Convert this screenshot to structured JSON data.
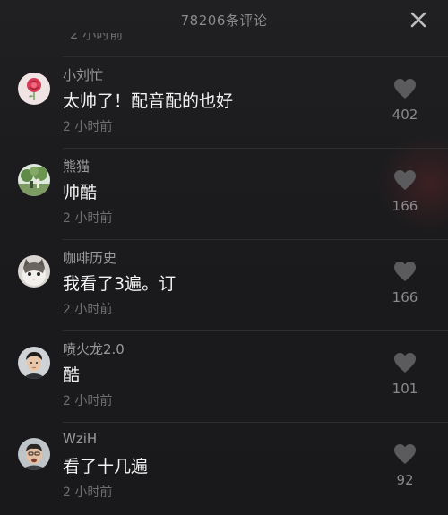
{
  "header": {
    "title": "78206条评论",
    "peek_text": "2 小时前"
  },
  "comments": [
    {
      "username": "小刘忙",
      "text": "太帅了！配音配的也好",
      "time": "2 小时前",
      "likes": "402",
      "avatar": "rose-avatar"
    },
    {
      "username": "熊猫",
      "text": "帅酷",
      "time": "2 小时前",
      "likes": "166",
      "avatar": "landscape-avatar"
    },
    {
      "username": "咖啡历史",
      "text": "我看了3遍。订",
      "time": "2 小时前",
      "likes": "166",
      "avatar": "cat-avatar"
    },
    {
      "username": "喷火龙2.0",
      "text": "酷",
      "time": "2 小时前",
      "likes": "101",
      "avatar": "person-avatar"
    },
    {
      "username": "WziH",
      "text": "看了十几遍",
      "time": "2 小时前",
      "likes": "92",
      "avatar": "person-avatar"
    }
  ],
  "icons": {
    "close": "close-icon",
    "like": "heart-icon"
  },
  "colors": {
    "background": "#1c1c1e",
    "text_primary": "#f2f2f2",
    "text_secondary": "#9a9a9d",
    "heart": "#5a5a5d"
  }
}
